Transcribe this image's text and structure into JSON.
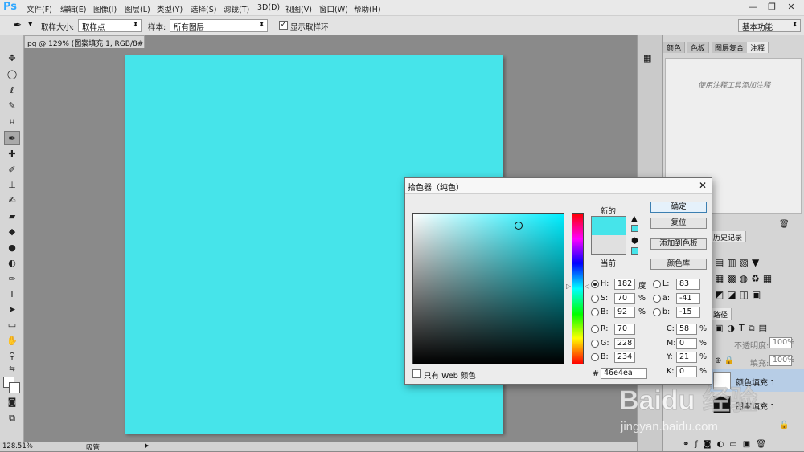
{
  "app": {
    "logo": "Ps"
  },
  "menu": [
    "文件(F)",
    "编辑(E)",
    "图像(I)",
    "图层(L)",
    "类型(Y)",
    "选择(S)",
    "滤镜(T)",
    "3D(D)",
    "视图(V)",
    "窗口(W)",
    "帮助(H)"
  ],
  "window_controls": {
    "minimize": "—",
    "restore": "❐",
    "close": "✕"
  },
  "options": {
    "sample_size_label": "取样大小:",
    "sample_size_value": "取样点",
    "sample_label": "样本:",
    "sample_value": "所有图层",
    "show_ring_label": "显示取样环",
    "show_ring_checked": "✓",
    "workspace": "基本功能"
  },
  "document": {
    "tab_title": "pg @ 129% (图案填充 1, RGB/8#) * ×",
    "canvas_color": "#46e4ea"
  },
  "status": {
    "zoom": "128.51%",
    "info": "吸管"
  },
  "panels": {
    "tabs": [
      "颜色",
      "色板",
      "图层复合",
      "注释"
    ],
    "notes_hint": "使用注释工具添加注释",
    "history_tab": "历史记录",
    "paths_tab": "路径",
    "opacity_label": "不透明度:",
    "opacity_value": "100%",
    "fill_label": "填充:",
    "fill_value": "100%",
    "layers": [
      "颜色填充 1",
      "图案填充 1"
    ]
  },
  "color_picker": {
    "title": "拾色器（纯色）",
    "close": "✕",
    "new_label": "新的",
    "current_label": "当前",
    "new_color": "#46e4ea",
    "current_color": "#e0e0e0",
    "buttons": {
      "ok": "确定",
      "reset": "复位",
      "add_swatch": "添加到色板",
      "library": "颜色库"
    },
    "fields": {
      "H": "182",
      "H_unit": "度",
      "S": "70",
      "S_unit": "%",
      "B": "92",
      "B_unit": "%",
      "R": "70",
      "G": "228",
      "Bv": "234",
      "L": "83",
      "a": "-41",
      "b": "-15",
      "C": "58",
      "M": "0",
      "Y": "21",
      "K": "0",
      "hex": "46e4ea"
    },
    "labels": {
      "H": "H:",
      "S": "S:",
      "B": "B:",
      "R": "R:",
      "G": "G:",
      "Bv": "B:",
      "L": "L:",
      "a": "a:",
      "b": "b:",
      "C": "C:",
      "M": "M:",
      "Y": "Y:",
      "K": "K:",
      "hash": "#"
    },
    "web_only_label": "只有 Web 颜色"
  },
  "watermark": {
    "brand": "Baidu 经验",
    "url": "jingyan.baidu.com"
  }
}
